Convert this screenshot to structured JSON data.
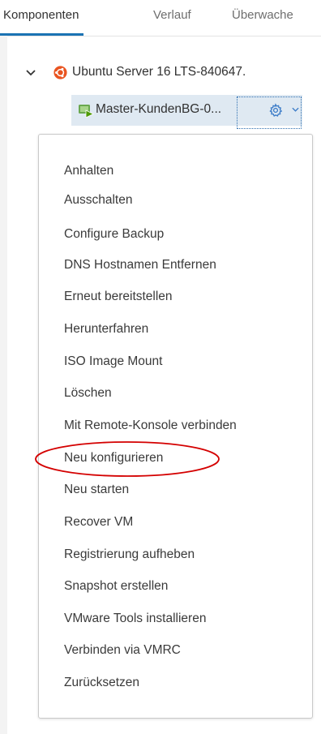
{
  "tabs": [
    {
      "label": "Komponenten",
      "active": true
    },
    {
      "label": "Verlauf",
      "active": false
    },
    {
      "label": "Überwache",
      "active": false
    }
  ],
  "tree": {
    "server_label": "Ubuntu Server 16 LTS-840647.",
    "vm_label": "Master-KundenBG-0..."
  },
  "menu": {
    "items": [
      "Anhalten",
      "Ausschalten",
      "Configure Backup",
      "DNS Hostnamen Entfernen",
      "Erneut bereitstellen",
      "Herunterfahren",
      "ISO Image Mount",
      "Löschen",
      "Mit Remote-Konsole verbinden",
      "Neu konfigurieren",
      "Neu starten",
      "Recover VM",
      "Registrierung aufheben",
      "Snapshot erstellen",
      "VMware Tools installieren",
      "Verbinden via VMRC",
      "Zurücksetzen"
    ],
    "highlighted_item": "Neu konfigurieren"
  },
  "colors": {
    "tab_underline": "#1b73b3",
    "selection_bg": "#dfe9f2",
    "highlight_circle": "#d40000",
    "ubuntu_orange": "#e95420",
    "vm_green": "#5aa500"
  },
  "icons": [
    "chevron-down-icon",
    "ubuntu-icon",
    "vm-running-icon",
    "gear-icon",
    "caret-down-icon"
  ]
}
